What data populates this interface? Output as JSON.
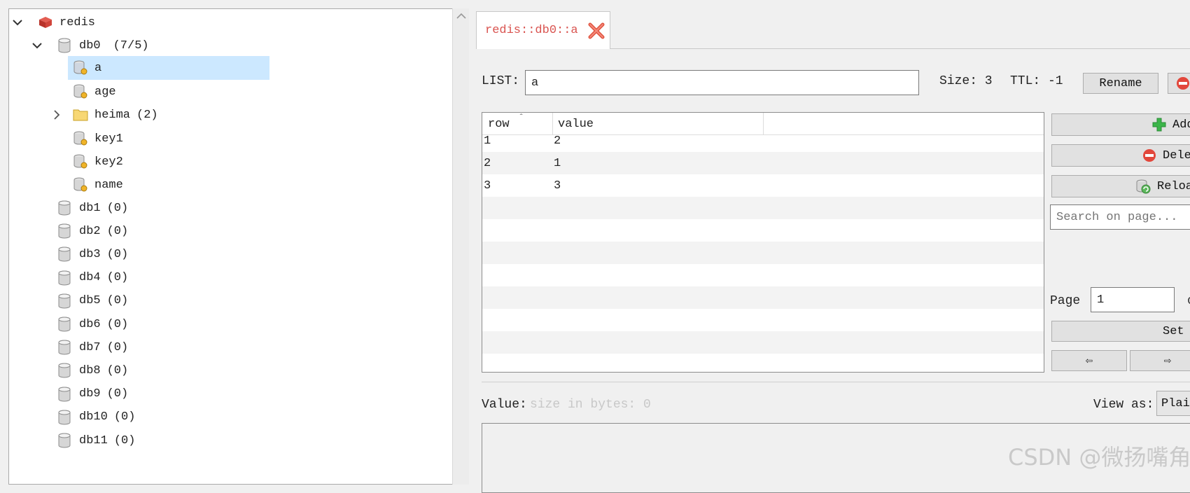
{
  "tree": {
    "server": "redis",
    "db0": {
      "name": "db0",
      "count": "(7/5)"
    },
    "keys": [
      "a",
      "age",
      "key1",
      "key2",
      "name"
    ],
    "folder": {
      "name": "heima",
      "count": "(2)"
    },
    "dbs": [
      {
        "name": "db1",
        "count": "(0)"
      },
      {
        "name": "db2",
        "count": "(0)"
      },
      {
        "name": "db3",
        "count": "(0)"
      },
      {
        "name": "db4",
        "count": "(0)"
      },
      {
        "name": "db5",
        "count": "(0)"
      },
      {
        "name": "db6",
        "count": "(0)"
      },
      {
        "name": "db7",
        "count": "(0)"
      },
      {
        "name": "db8",
        "count": "(0)"
      },
      {
        "name": "db9",
        "count": "(0)"
      },
      {
        "name": "db10",
        "count": "(0)"
      },
      {
        "name": "db11",
        "count": "(0)"
      }
    ]
  },
  "tab": {
    "title": "redis::db0::a"
  },
  "key_bar": {
    "type_label": "LIST:",
    "key_value": "a",
    "size_label": "Size: 3",
    "ttl_label": "TTL: -1",
    "rename_label": "Rename"
  },
  "table": {
    "columns": [
      "row",
      "value"
    ],
    "rows": [
      {
        "row": "1",
        "value": "2"
      },
      {
        "row": "2",
        "value": "1"
      },
      {
        "row": "3",
        "value": "3"
      }
    ]
  },
  "side_buttons": {
    "add_label": "Add",
    "delete_label": "Dele",
    "reload_label": "Reloa",
    "search_placeholder": "Search on page...",
    "page_label": "Page",
    "page_value": "1",
    "page_of": "o",
    "set_label": "Set",
    "prev_label": "⇦",
    "next_label": "⇨"
  },
  "value_bar": {
    "label": "Value:",
    "size_hint": "size in bytes: 0",
    "view_as_label": "View as:",
    "view_as_value": "Plai"
  },
  "watermark": "CSDN @微扬嘴角",
  "colors": {
    "selection": "#cce8ff",
    "tab_title": "#d9534f",
    "redis_red": "#c9302c"
  }
}
